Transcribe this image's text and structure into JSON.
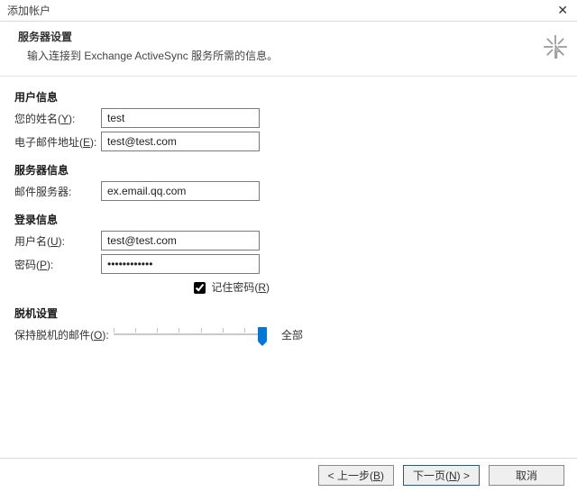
{
  "window": {
    "title": "添加帐户"
  },
  "header": {
    "title": "服务器设置",
    "subtitle": "输入连接到 Exchange ActiveSync 服务所需的信息。"
  },
  "sections": {
    "user_info": "用户信息",
    "server_info": "服务器信息",
    "login_info": "登录信息",
    "offline": "脱机设置"
  },
  "fields": {
    "name": {
      "label_pre": "您的姓名(",
      "hotkey": "Y",
      "label_post": "):",
      "value": "test"
    },
    "email": {
      "label_pre": "电子邮件地址(",
      "hotkey": "E",
      "label_post": "):",
      "value": "test@test.com"
    },
    "mailserver": {
      "label": "邮件服务器:",
      "value": "ex.email.qq.com"
    },
    "username": {
      "label_pre": "用户名(",
      "hotkey": "U",
      "label_post": "):",
      "value": "test@test.com"
    },
    "password": {
      "label_pre": "密码(",
      "hotkey": "P",
      "label_post": "):",
      "value": "************"
    },
    "remember": {
      "label_pre": "记住密码(",
      "hotkey": "R",
      "label_post": ")",
      "checked": true
    },
    "offline_mail": {
      "label_pre": "保持脱机的邮件(",
      "hotkey": "O",
      "label_post": "):",
      "value_text": "全部"
    }
  },
  "footer": {
    "back": {
      "pre": "< 上一步(",
      "hotkey": "B",
      "post": ")"
    },
    "next": {
      "pre": "下一页(",
      "hotkey": "N",
      "post": ") >"
    },
    "cancel": "取消"
  }
}
